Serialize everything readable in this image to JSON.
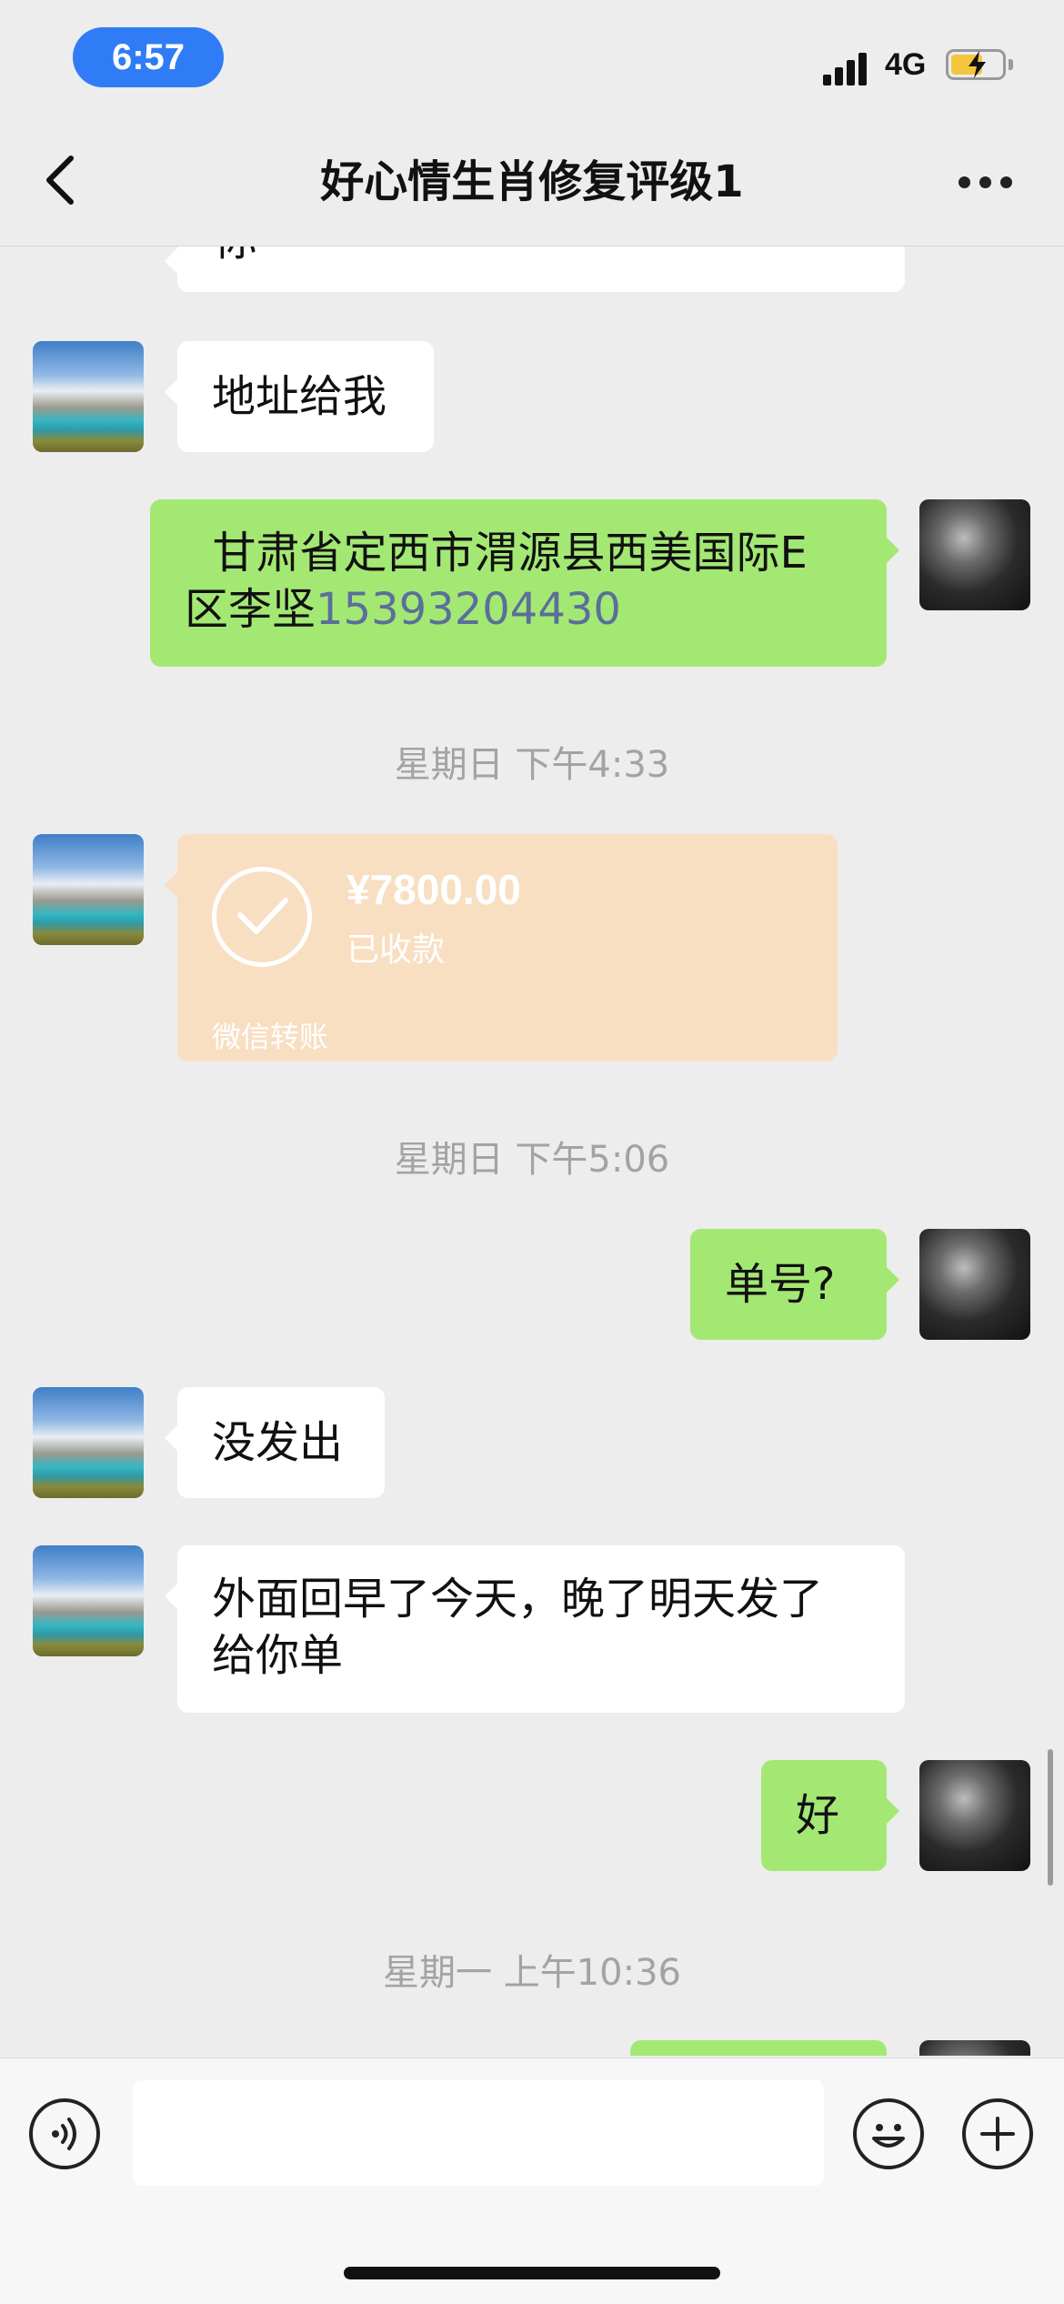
{
  "status_bar": {
    "time": "6:57",
    "network": "4G",
    "battery_color": "#f3c63b",
    "time_pill_color": "#2f7cf6"
  },
  "header": {
    "title": "好心情生肖修复评级1",
    "back_icon": "chevron-left-icon",
    "more_icon": "more-dots-icon"
  },
  "messages": {
    "clipped_top_text": "你",
    "m1": {
      "side": "left",
      "text": "地址给我"
    },
    "m2": {
      "side": "right",
      "line1": "  甘肃省定西市渭源县西美国际E",
      "line2_prefix": "区李坚",
      "phone": "15393204430"
    },
    "ts1": "星期日 下午4:33",
    "transfer": {
      "amount": "¥7800.00",
      "status": "已收款",
      "label": "微信转账",
      "icon": "check-circle-icon"
    },
    "ts2": "星期日 下午5:06",
    "m3": {
      "side": "right",
      "text": "单号?"
    },
    "m4": {
      "side": "left",
      "text": "没发出"
    },
    "m5": {
      "side": "left",
      "line1": "外面回早了今天，晚了明天发了",
      "line2": "给你单"
    },
    "m6": {
      "side": "right",
      "text": "好"
    },
    "ts3": "星期一 上午10:36"
  },
  "input_bar": {
    "voice_icon": "voice-icon",
    "emoji_icon": "emoji-icon",
    "plus_icon": "plus-icon",
    "value": ""
  },
  "colors": {
    "sent_bubble": "#a4e874",
    "received_bubble": "#ffffff",
    "background": "#ededed",
    "transfer_card": "#f8dfc2"
  }
}
